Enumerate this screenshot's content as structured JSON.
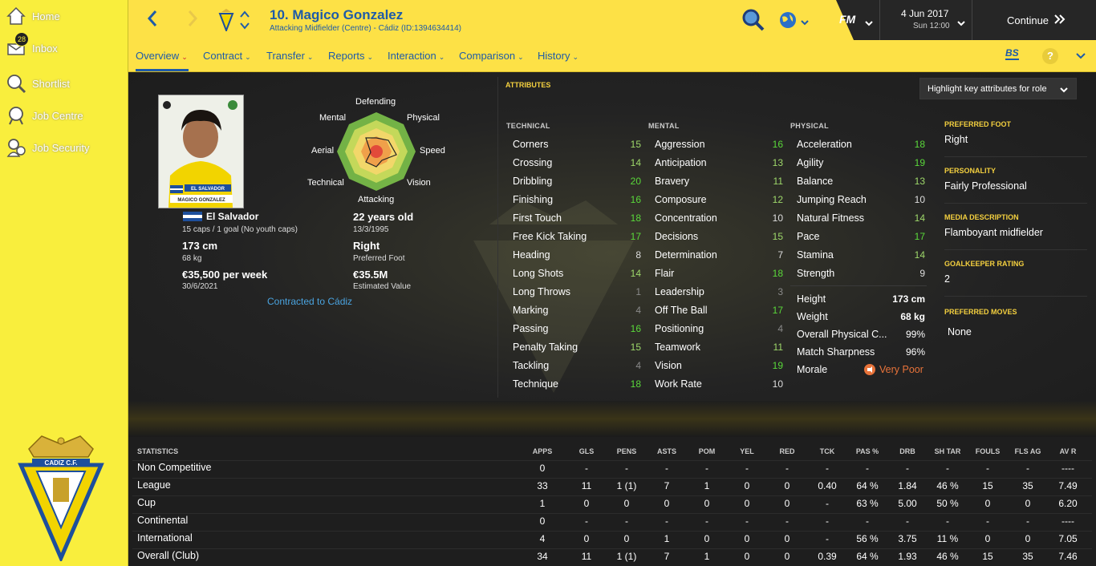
{
  "sidebar": {
    "items": [
      {
        "label": "Home",
        "icon": "home-icon"
      },
      {
        "label": "Inbox",
        "icon": "inbox-icon",
        "badge": "28"
      },
      {
        "label": "Shortlist",
        "icon": "shortlist-icon"
      },
      {
        "label": "Job Centre",
        "icon": "job-centre-icon"
      },
      {
        "label": "Job Security",
        "icon": "job-security-icon"
      }
    ],
    "crest_text": "CADIZ C.F."
  },
  "header": {
    "player_name": "10. Magico Gonzalez",
    "player_sub": "Attacking Midfielder (Centre) - Cádiz (ID:1394634414)",
    "fm_logo": "FM",
    "date": "4 Jun 2017",
    "time": "Sun 12:00",
    "continue": "Continue"
  },
  "tabs": [
    {
      "label": "Overview"
    },
    {
      "label": "Contract"
    },
    {
      "label": "Transfer"
    },
    {
      "label": "Reports"
    },
    {
      "label": "Interaction"
    },
    {
      "label": "Comparison"
    },
    {
      "label": "History"
    }
  ],
  "tab_right": {
    "bs": "BS",
    "help": "?"
  },
  "profile": {
    "sticker_top": "EL SALVADOR",
    "sticker_bottom": "MAGICO GONZALEZ",
    "nation": "El Salvador",
    "caps": "15 caps / 1 goal (No youth caps)",
    "height": "173 cm",
    "weight": "68 kg",
    "wage": "€35,500 per week",
    "contract_end": "30/6/2021",
    "age": "22 years old",
    "dob": "13/3/1995",
    "foot": "Right",
    "foot_lbl": "Preferred Foot",
    "value": "€35.5M",
    "value_lbl": "Estimated Value",
    "contracted": "Contracted to Cádiz"
  },
  "radar": {
    "labels": {
      "defending": "Defending",
      "physical": "Physical",
      "speed": "Speed",
      "vision": "Vision",
      "attacking": "Attacking",
      "technical": "Technical",
      "aerial": "Aerial",
      "mental": "Mental"
    }
  },
  "attributes": {
    "heading": "ATTRIBUTES",
    "highlight": "Highlight key attributes for role",
    "technical": {
      "title": "TECHNICAL",
      "items": [
        [
          "Corners",
          "15"
        ],
        [
          "Crossing",
          "14"
        ],
        [
          "Dribbling",
          "20"
        ],
        [
          "Finishing",
          "16"
        ],
        [
          "First Touch",
          "18"
        ],
        [
          "Free Kick Taking",
          "17"
        ],
        [
          "Heading",
          "8"
        ],
        [
          "Long Shots",
          "14"
        ],
        [
          "Long Throws",
          "1"
        ],
        [
          "Marking",
          "4"
        ],
        [
          "Passing",
          "16"
        ],
        [
          "Penalty Taking",
          "15"
        ],
        [
          "Tackling",
          "4"
        ],
        [
          "Technique",
          "18"
        ]
      ]
    },
    "mental": {
      "title": "MENTAL",
      "items": [
        [
          "Aggression",
          "16"
        ],
        [
          "Anticipation",
          "13"
        ],
        [
          "Bravery",
          "11"
        ],
        [
          "Composure",
          "12"
        ],
        [
          "Concentration",
          "10"
        ],
        [
          "Decisions",
          "15"
        ],
        [
          "Determination",
          "7"
        ],
        [
          "Flair",
          "18"
        ],
        [
          "Leadership",
          "3"
        ],
        [
          "Off The Ball",
          "17"
        ],
        [
          "Positioning",
          "4"
        ],
        [
          "Teamwork",
          "11"
        ],
        [
          "Vision",
          "19"
        ],
        [
          "Work Rate",
          "10"
        ]
      ]
    },
    "physical": {
      "title": "PHYSICAL",
      "items": [
        [
          "Acceleration",
          "18"
        ],
        [
          "Agility",
          "19"
        ],
        [
          "Balance",
          "13"
        ],
        [
          "Jumping Reach",
          "10"
        ],
        [
          "Natural Fitness",
          "14"
        ],
        [
          "Pace",
          "17"
        ],
        [
          "Stamina",
          "14"
        ],
        [
          "Strength",
          "9"
        ]
      ]
    },
    "extras": [
      [
        "Height",
        "173 cm"
      ],
      [
        "Weight",
        "68 kg"
      ],
      [
        "Overall Physical C...",
        "99%"
      ],
      [
        "Match Sharpness",
        "96%"
      ]
    ],
    "morale": {
      "label": "Morale",
      "value": "Very Poor"
    }
  },
  "right_panel": [
    {
      "h": "PREFERRED FOOT",
      "v": "Right"
    },
    {
      "h": "PERSONALITY",
      "v": "Fairly Professional"
    },
    {
      "h": "MEDIA DESCRIPTION",
      "v": "Flamboyant midfielder"
    },
    {
      "h": "GOALKEEPER RATING",
      "v": "2"
    },
    {
      "h": "PREFERRED MOVES",
      "v": "None"
    }
  ],
  "statistics": {
    "title": "STATISTICS",
    "columns": [
      "APPS",
      "GLS",
      "PENS",
      "ASTS",
      "POM",
      "YEL",
      "RED",
      "TCK",
      "PAS %",
      "DRB",
      "SH TAR",
      "FOULS",
      "FLS AG",
      "AV R"
    ],
    "rows": [
      {
        "label": "Non Competitive",
        "cells": [
          "0",
          "-",
          "-",
          "-",
          "-",
          "-",
          "-",
          "-",
          "-",
          "-",
          "-",
          "-",
          "-",
          "----"
        ]
      },
      {
        "label": "League",
        "cells": [
          "33",
          "11",
          "1 (1)",
          "7",
          "1",
          "0",
          "0",
          "0.40",
          "64 %",
          "1.84",
          "46 %",
          "15",
          "35",
          "7.49"
        ]
      },
      {
        "label": "Cup",
        "cells": [
          "1",
          "0",
          "0",
          "0",
          "0",
          "0",
          "0",
          "-",
          "63 %",
          "5.00",
          "50 %",
          "0",
          "0",
          "6.20"
        ]
      },
      {
        "label": "Continental",
        "cells": [
          "0",
          "-",
          "-",
          "-",
          "-",
          "-",
          "-",
          "-",
          "-",
          "-",
          "-",
          "-",
          "-",
          "----"
        ]
      },
      {
        "label": "International",
        "cells": [
          "4",
          "0",
          "0",
          "1",
          "0",
          "0",
          "0",
          "-",
          "56 %",
          "3.75",
          "11 %",
          "0",
          "0",
          "7.05"
        ]
      },
      {
        "label": "Overall (Club)",
        "cells": [
          "34",
          "11",
          "1 (1)",
          "7",
          "1",
          "0",
          "0",
          "0.39",
          "64 %",
          "1.93",
          "46 %",
          "15",
          "35",
          "7.46"
        ]
      }
    ]
  }
}
